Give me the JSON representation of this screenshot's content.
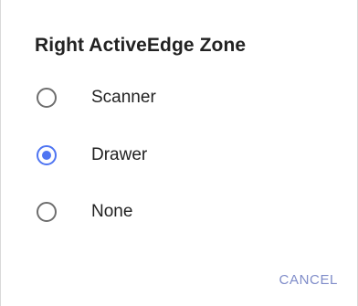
{
  "dialog": {
    "title": "Right ActiveEdge Zone",
    "options": [
      {
        "label": "Scanner",
        "selected": false
      },
      {
        "label": "Drawer",
        "selected": true
      },
      {
        "label": "None",
        "selected": false
      }
    ],
    "cancel_label": "CANCEL"
  },
  "colors": {
    "accent": "#4f75f2",
    "radio_unchecked": "#6e6e6e",
    "cancel_text": "#7f8cc9",
    "text": "#222222"
  }
}
